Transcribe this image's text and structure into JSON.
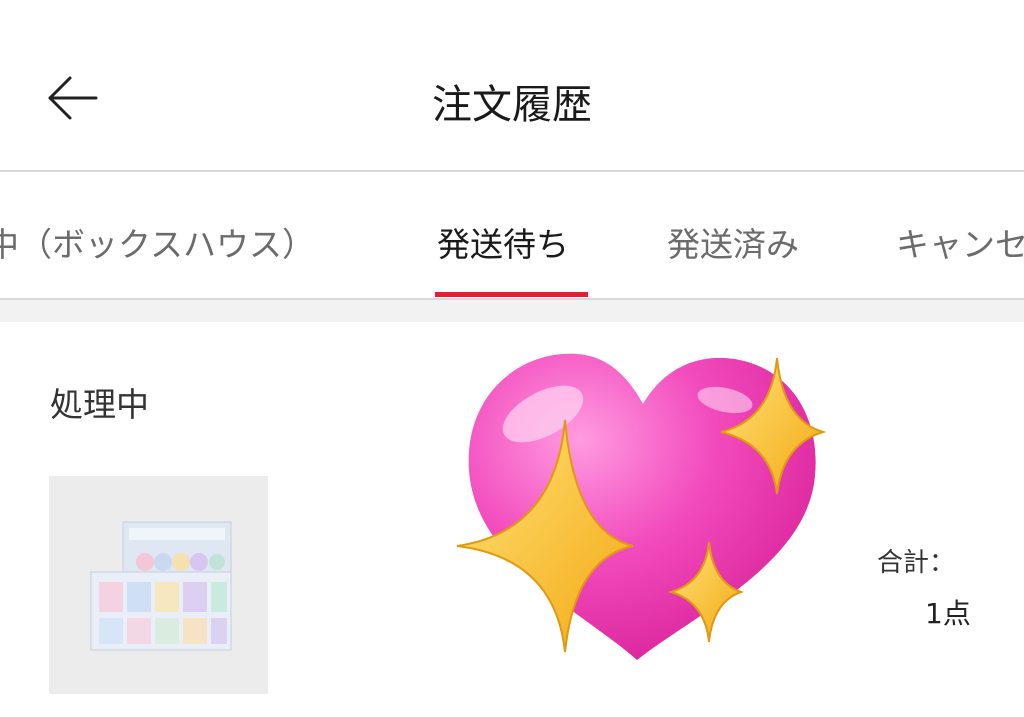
{
  "header": {
    "title": "注文履歴",
    "back_icon": "back-arrow-icon"
  },
  "tabs": [
    {
      "label": "中（ボックスハウス）",
      "active": false
    },
    {
      "label": "発送待ち",
      "active": true
    },
    {
      "label": "発送済み",
      "active": false
    },
    {
      "label": "キャンセ",
      "active": false
    }
  ],
  "order": {
    "status": "処理中",
    "total_label": "合計：",
    "quantity": "1点"
  },
  "colors": {
    "accent": "#e0212f",
    "heart": "#f048b8",
    "sparkle": "#f8c52c"
  },
  "sticker": "sparkling-heart-icon"
}
